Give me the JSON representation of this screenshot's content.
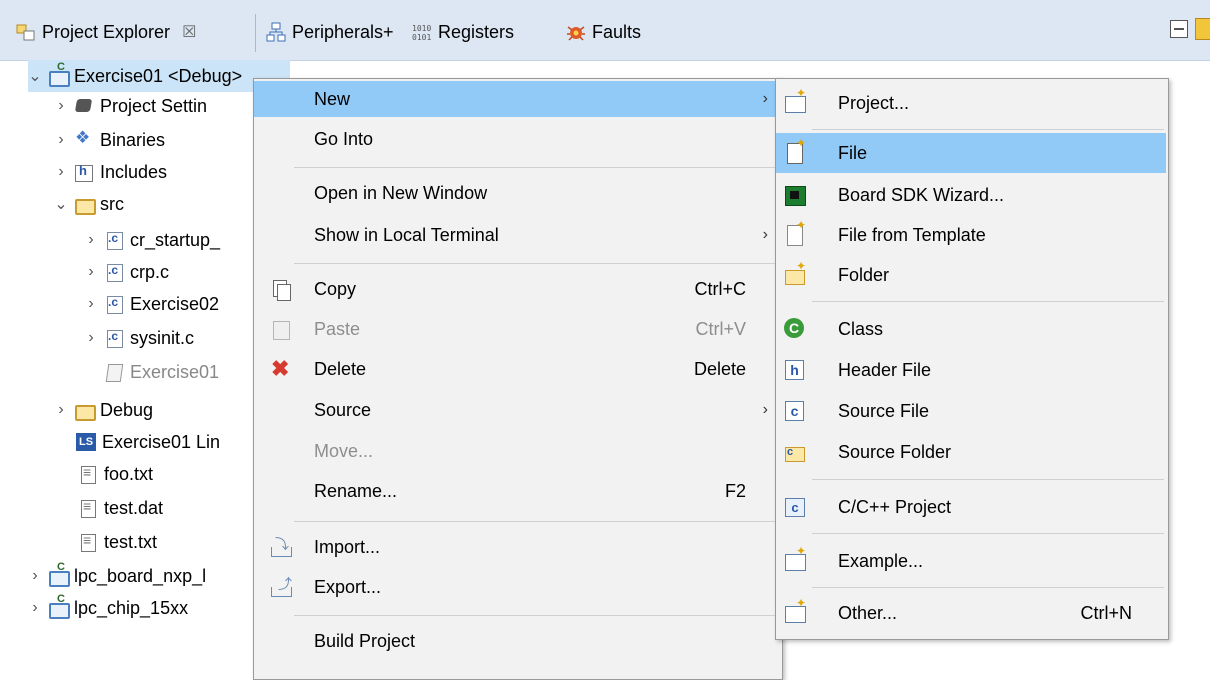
{
  "tabs": [
    {
      "label": "Project Explorer",
      "close": "☒"
    },
    {
      "label": "Peripherals+"
    },
    {
      "label": "Registers"
    },
    {
      "label": "Faults"
    }
  ],
  "tree": {
    "items": [
      {
        "label": "Exercise01 <Debug>"
      },
      {
        "label": "Project Settin"
      },
      {
        "label": "Binaries"
      },
      {
        "label": "Includes"
      },
      {
        "label": "src"
      },
      {
        "label": "cr_startup_"
      },
      {
        "label": "crp.c"
      },
      {
        "label": "Exercise02"
      },
      {
        "label": "sysinit.c"
      },
      {
        "label": "Exercise01"
      },
      {
        "label": "Debug"
      },
      {
        "label": "Exercise01 Lin"
      },
      {
        "label": "foo.txt"
      },
      {
        "label": "test.dat"
      },
      {
        "label": "test.txt"
      },
      {
        "label": "lpc_board_nxp_l"
      },
      {
        "label": "lpc_chip_15xx"
      }
    ]
  },
  "context_menu": {
    "items": [
      {
        "label": "New"
      },
      {
        "label": "Go Into"
      },
      {
        "label": "Open in New Window"
      },
      {
        "label": "Show in Local Terminal"
      },
      {
        "label": "Copy",
        "shortcut": "Ctrl+C"
      },
      {
        "label": "Paste",
        "shortcut": "Ctrl+V"
      },
      {
        "label": "Delete",
        "shortcut": "Delete"
      },
      {
        "label": "Source"
      },
      {
        "label": "Move..."
      },
      {
        "label": "Rename...",
        "shortcut": "F2"
      },
      {
        "label": "Import..."
      },
      {
        "label": "Export..."
      },
      {
        "label": "Build Project"
      }
    ],
    "submenu_arrow": "›"
  },
  "submenu": {
    "items": [
      {
        "label": "Project..."
      },
      {
        "label": "File"
      },
      {
        "label": "Board SDK Wizard..."
      },
      {
        "label": "File from Template"
      },
      {
        "label": "Folder"
      },
      {
        "label": "Class"
      },
      {
        "label": "Header File"
      },
      {
        "label": "Source File"
      },
      {
        "label": "Source Folder"
      },
      {
        "label": "C/C++ Project"
      },
      {
        "label": "Example..."
      },
      {
        "label": "Other...",
        "shortcut": "Ctrl+N"
      }
    ]
  },
  "colors": {
    "tab_bar": "#dce7f3",
    "menu_bg": "#f2f2f2",
    "menu_highlight": "#91c9f7",
    "tree_selection": "#cce4f7",
    "disabled_text": "#8e8e8e"
  }
}
